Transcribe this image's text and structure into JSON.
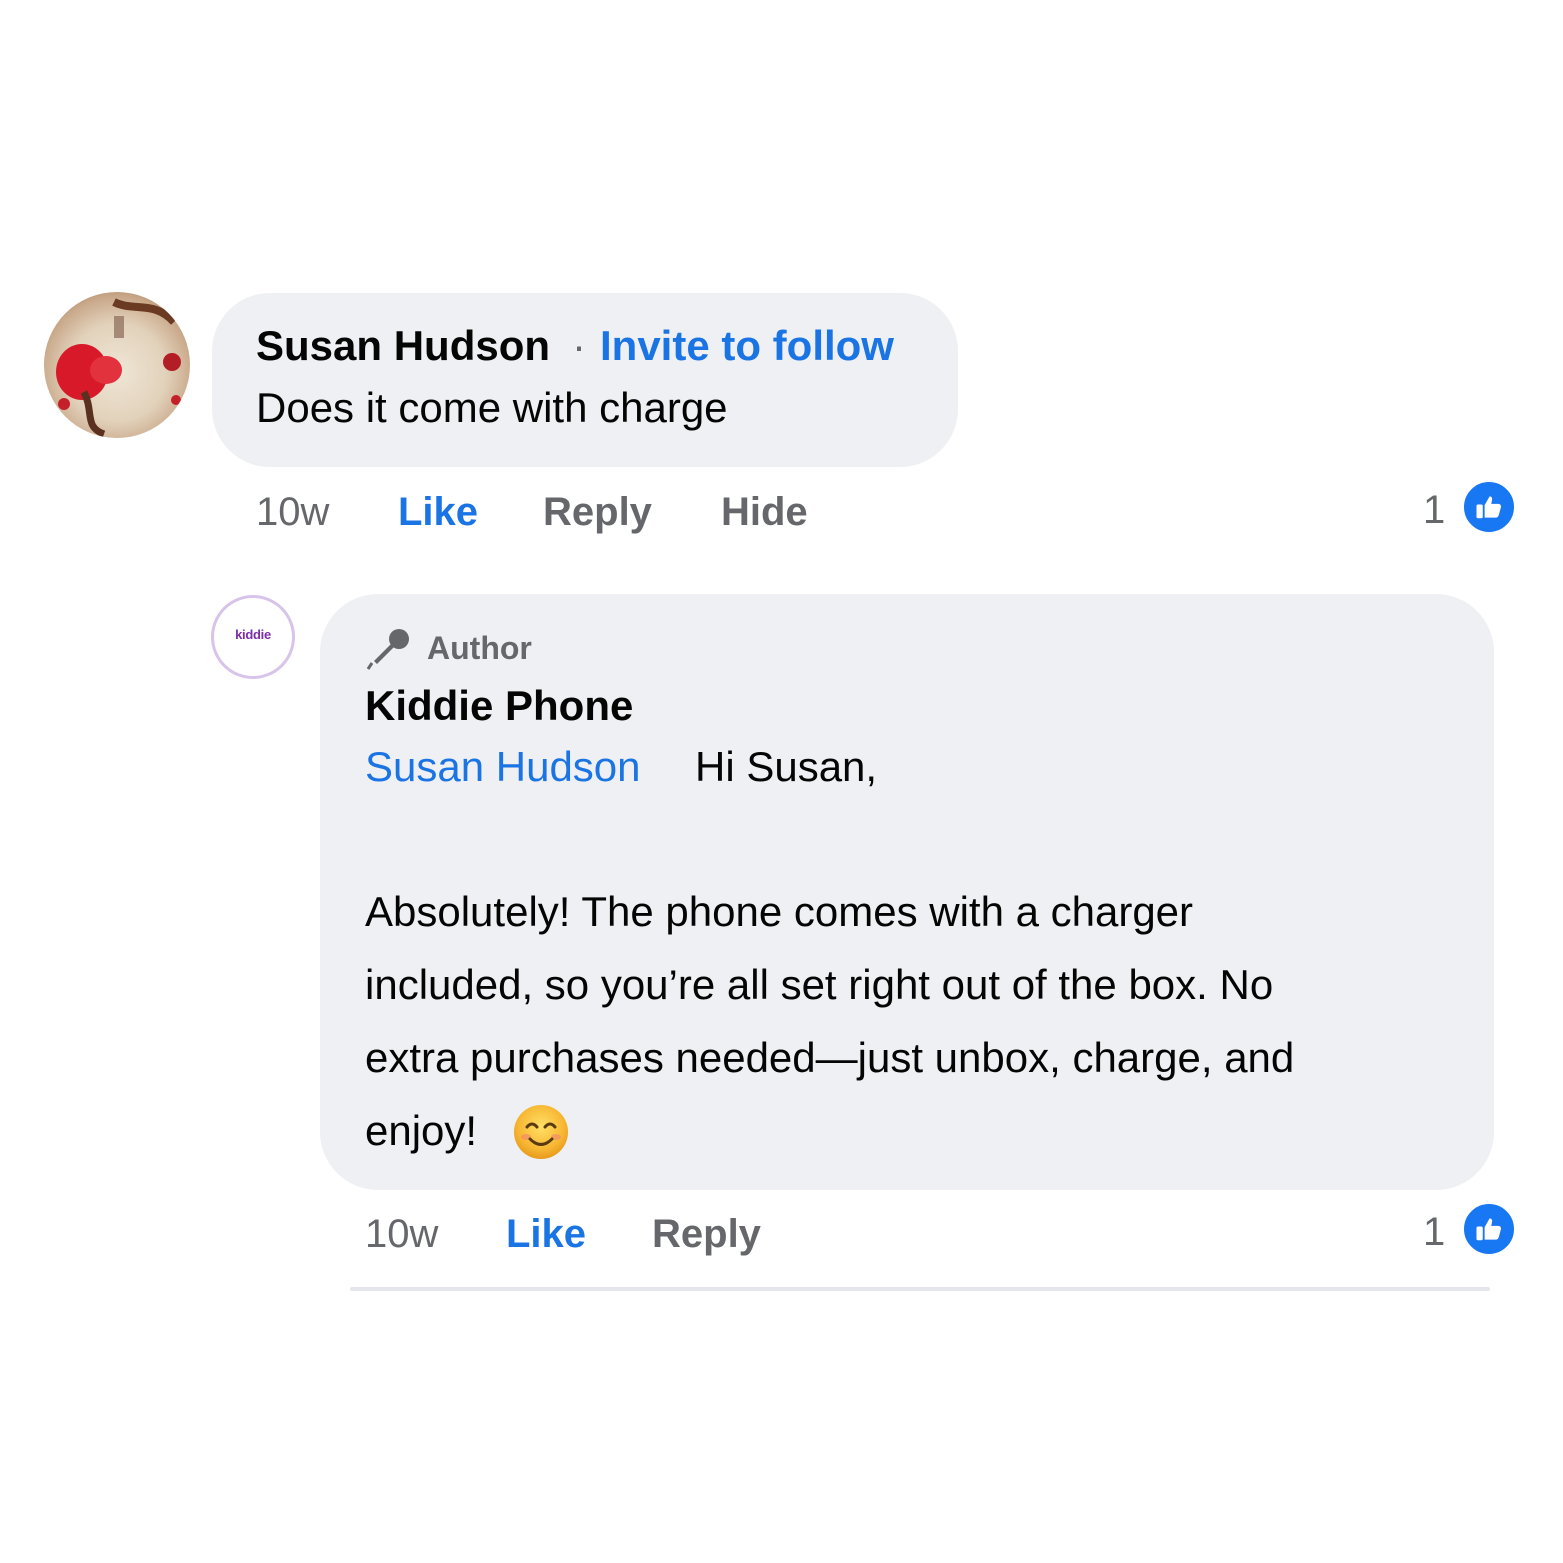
{
  "comment": {
    "author": "Susan Hudson",
    "separator": "·",
    "invite_label": "Invite to follow",
    "text": "Does it come with charge",
    "time": "10w",
    "like_label": "Like",
    "reply_label": "Reply",
    "hide_label": "Hide",
    "reaction_count": "1"
  },
  "reply": {
    "badge_label": "Author",
    "author": "Kiddie Phone",
    "avatar_logo_text": "kiddie",
    "mention": "Susan Hudson",
    "greeting": "Hi Susan,",
    "body_lines": [
      "Absolutely! The phone comes with a charger",
      "included, so you’re all set right out of the box. No",
      "extra purchases needed—just unbox, charge, and",
      "enjoy!"
    ],
    "emoji": "smiling-face-with-smiling-eyes",
    "time": "10w",
    "like_label": "Like",
    "reply_label": "Reply",
    "reaction_count": "1"
  },
  "colors": {
    "link_blue": "#1b74e4",
    "like_badge_blue": "#1877f2",
    "bubble_gray": "#eff0f3",
    "meta_gray": "#65676b"
  }
}
